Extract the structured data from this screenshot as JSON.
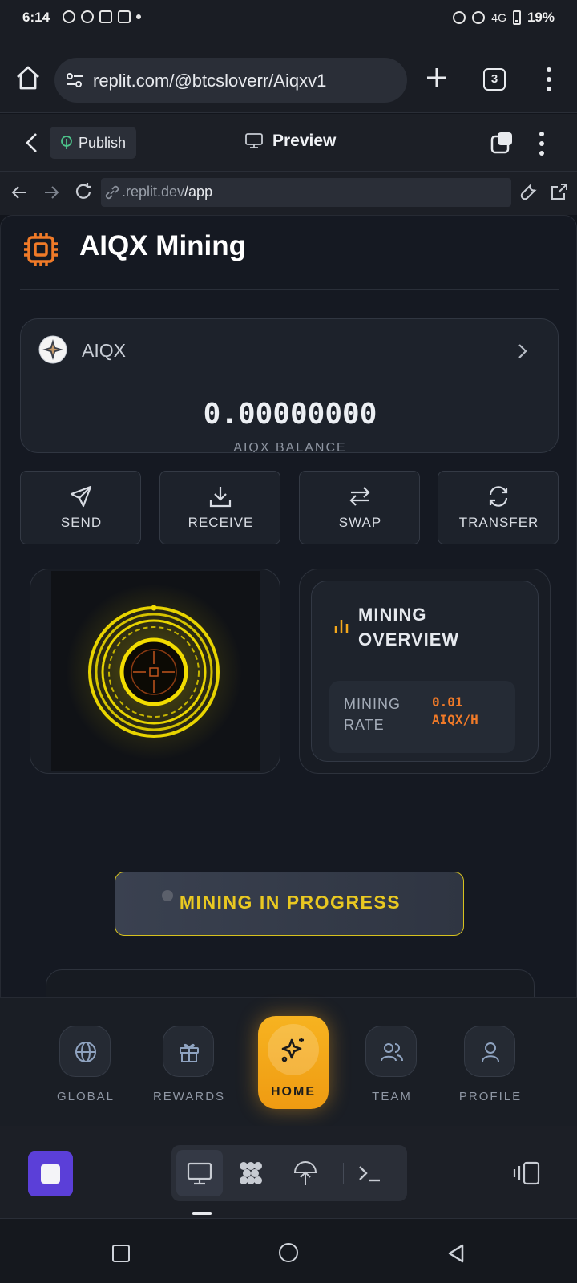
{
  "status_bar": {
    "time": "6:14",
    "battery": "19%",
    "network": "4G"
  },
  "browser": {
    "url": "replit.com/@btcsloverr/Aiqxv1",
    "tab_count": "3"
  },
  "replit_header": {
    "publish_label": "Publish",
    "preview_label": "Preview"
  },
  "webview": {
    "url_prefix": ".replit.dev",
    "url_path": "/app"
  },
  "app": {
    "title": "AIQX Mining",
    "balance": {
      "coin": "AIQX",
      "value": "0.00000000",
      "label": "AIQX BALANCE"
    },
    "actions": [
      {
        "label": "SEND",
        "icon": "send-icon"
      },
      {
        "label": "RECEIVE",
        "icon": "download-icon"
      },
      {
        "label": "SWAP",
        "icon": "swap-icon"
      },
      {
        "label": "TRANSFER",
        "icon": "refresh-icon"
      }
    ],
    "overview": {
      "title_line1": "MINING",
      "title_line2": "OVERVIEW",
      "rate_label_line1": "MINING",
      "rate_label_line2": "RATE",
      "rate_value_line1": "0.01",
      "rate_value_line2": "AIQX/H"
    },
    "mining_button": "MINING IN PROGRESS",
    "nav": [
      {
        "label": "GLOBAL",
        "icon": "globe-icon"
      },
      {
        "label": "REWARDS",
        "icon": "gift-icon"
      },
      {
        "label": "HOME",
        "icon": "sparkles-icon",
        "active": true
      },
      {
        "label": "TEAM",
        "icon": "users-icon"
      },
      {
        "label": "PROFILE",
        "icon": "user-icon"
      }
    ]
  },
  "colors": {
    "accent_orange": "#f07a28",
    "gold": "#e9c821",
    "nav_active": "#f4a81c",
    "stop_button": "#5b3fd8"
  }
}
